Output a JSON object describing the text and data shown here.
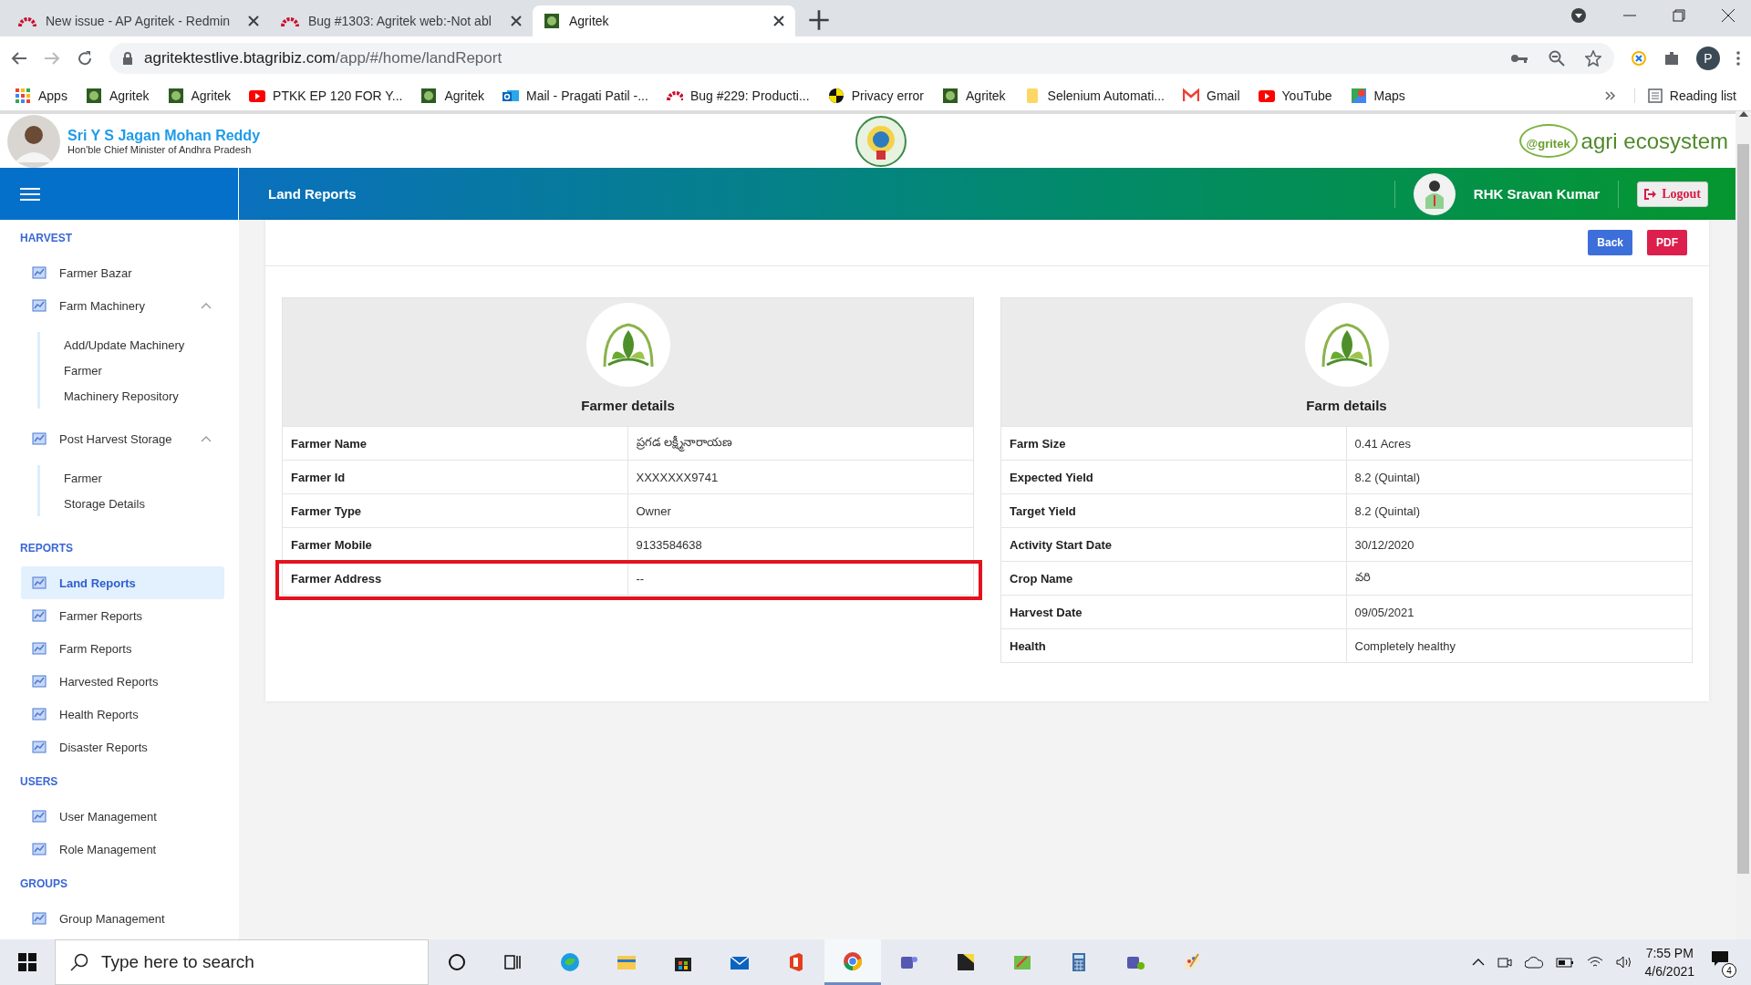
{
  "browser": {
    "tabs": [
      {
        "title": "New issue - AP Agritek - Redmin",
        "selected": false
      },
      {
        "title": "Bug #1303: Agritek web:-Not abl",
        "selected": false
      },
      {
        "title": "Agritek",
        "selected": true
      }
    ],
    "address": {
      "host": "agritektestlive.btagribiz.com",
      "path": "/app/#/home/landReport"
    },
    "bookmarks": [
      "Apps",
      "Agritek",
      "Agritek",
      "PTKK EP 120 FOR Y...",
      "Agritek",
      "Mail - Pragati Patil -...",
      "Bug #229: Producti...",
      "Privacy error",
      "Agritek",
      "Selenium Automati...",
      "Gmail",
      "YouTube",
      "Maps"
    ],
    "reading_list": "Reading list",
    "profile_initial": "P"
  },
  "header": {
    "leader_name": "Sri Y S Jagan Mohan Reddy",
    "leader_title": "Hon'ble Chief Minister of Andhra Pradesh",
    "logo_mark": "@gritek",
    "logo_text": "agri ecosystem"
  },
  "topbar": {
    "title": "Land Reports",
    "user": "RHK Sravan Kumar",
    "logout": "Logout"
  },
  "sidebar": {
    "sections": [
      {
        "title": "HARVEST",
        "items": [
          {
            "label": "Farmer Bazar",
            "selected": false
          },
          {
            "label": "Farm Machinery",
            "selected": false,
            "expanded": true,
            "children": [
              {
                "label": "Add/Update Machinery",
                "selected": false
              },
              {
                "label": "Farmer",
                "selected": false
              },
              {
                "label": "Machinery Repository",
                "selected": false
              }
            ]
          },
          {
            "label": "Post Harvest Storage",
            "selected": false,
            "expanded": true,
            "children": [
              {
                "label": "Farmer",
                "selected": false
              },
              {
                "label": "Storage Details",
                "selected": false
              }
            ]
          }
        ]
      },
      {
        "title": "REPORTS",
        "items": [
          {
            "label": "Land Reports",
            "selected": true
          },
          {
            "label": "Farmer Reports",
            "selected": false
          },
          {
            "label": "Farm Reports",
            "selected": false
          },
          {
            "label": "Harvested Reports",
            "selected": false
          },
          {
            "label": "Health Reports",
            "selected": false
          },
          {
            "label": "Disaster Reports",
            "selected": false
          }
        ]
      },
      {
        "title": "USERS",
        "items": [
          {
            "label": "User Management",
            "selected": false
          },
          {
            "label": "Role Management",
            "selected": false
          }
        ]
      },
      {
        "title": "GROUPS",
        "items": [
          {
            "label": "Group Management",
            "selected": false
          }
        ]
      }
    ]
  },
  "actions": [
    "Back",
    "PDF"
  ],
  "panels": [
    {
      "title": "Farmer details",
      "rows": [
        {
          "label": "Farmer Name",
          "value": "ప్రగడ లక్ష్మీనారాయణ",
          "highlighted": false
        },
        {
          "label": "Farmer Id",
          "value": "XXXXXXX9741",
          "highlighted": false
        },
        {
          "label": "Farmer Type",
          "value": "Owner",
          "highlighted": false
        },
        {
          "label": "Farmer Mobile",
          "value": "9133584638",
          "highlighted": false
        },
        {
          "label": "Farmer Address",
          "value": "--",
          "highlighted": true
        }
      ]
    },
    {
      "title": "Farm details",
      "rows": [
        {
          "label": "Farm Size",
          "value": "0.41 Acres",
          "highlighted": false
        },
        {
          "label": "Expected Yield",
          "value": "8.2 (Quintal)",
          "highlighted": false
        },
        {
          "label": "Target Yield",
          "value": "8.2 (Quintal)",
          "highlighted": false
        },
        {
          "label": "Activity Start Date",
          "value": "30/12/2020",
          "highlighted": false
        },
        {
          "label": "Crop Name",
          "value": "వరి",
          "highlighted": false
        },
        {
          "label": "Harvest Date",
          "value": "09/05/2021",
          "highlighted": false
        },
        {
          "label": "Health",
          "value": "Completely healthy",
          "highlighted": false
        }
      ]
    }
  ],
  "taskbar": {
    "search_placeholder": "Type here to search",
    "time": "7:55 PM",
    "date": "4/6/2021",
    "notifications": "4"
  }
}
